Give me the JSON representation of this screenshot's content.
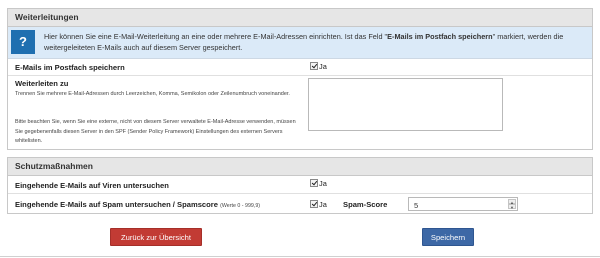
{
  "weiterleitungen": {
    "title": "Weiterleitungen",
    "info_icon": "?",
    "info_pre": "Hier können Sie eine E-Mail-Weiterleitung an eine oder mehrere E-Mail-Adressen einrichten. Ist das Feld \"",
    "info_bold": "E-Mails im Postfach speichern",
    "info_post": "\" markiert, werden die weitergeleiteten E-Mails auch auf diesem Server gespeichert.",
    "store_label": "E-Mails im Postfach speichern",
    "store_checked": true,
    "store_value_label": "Ja",
    "forward_label": "Weiterleiten zu",
    "forward_hint1": "Trennen Sie mehrere E-Mail-Adressen durch Leerzeichen, Komma, Semikolon oder Zeilenumbruch voneinander.",
    "forward_hint2": "Bitte beachten Sie, wenn Sie eine externe, nicht von diesem Server verwaltete E-Mail-Adresse verwenden, müssen Sie gegebenenfalls diesen Server in den SPF (Sender Policy Framework) Einstellungen des externen Servers whitelisten.",
    "forward_value": ""
  },
  "schutz": {
    "title": "Schutzmaßnahmen",
    "virus_label": "Eingehende E-Mails auf Viren untersuchen",
    "virus_checked": true,
    "virus_value_label": "Ja",
    "spam_label": "Eingehende E-Mails auf Spam untersuchen / Spamscore",
    "spam_range": "(Werte 0 - 999,9)",
    "spam_checked": true,
    "spam_value_label": "Ja",
    "spamscore_label": "Spam-Score",
    "spamscore_value": "5"
  },
  "buttons": {
    "back": "Zurück zur Übersicht",
    "save": "Speichern"
  },
  "colors": {
    "info_bg": "#dbeaf8",
    "info_icon": "#1f6fb0",
    "back_button": "#c23b34",
    "save_button": "#3d68a6"
  }
}
